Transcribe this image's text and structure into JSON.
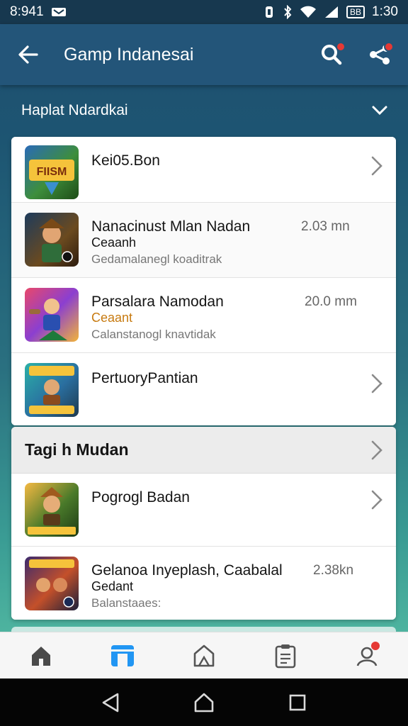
{
  "status_bar": {
    "time_left": "8:941",
    "time_right": "1:30",
    "battery_label": "BB"
  },
  "app_bar": {
    "title": "Gamp Indanesai"
  },
  "section": {
    "title": "Haplat Ndardkai"
  },
  "list1": [
    {
      "title": "Kei05.Bon",
      "subtitle": "",
      "meta": "",
      "size": "",
      "icon": "game-thumbnail-icon"
    },
    {
      "title": "Nanacinust Mlan Nadan",
      "subtitle": "Ceaanh",
      "meta": "Gedamalanegl koaditrak",
      "size": "2.03 mn",
      "icon": "game-thumbnail-icon"
    },
    {
      "title": "Parsalara Namodan",
      "subtitle": "Ceaant",
      "meta": "Calanstanogl knavtidak",
      "size": "20.0 mm",
      "icon": "game-thumbnail-icon"
    },
    {
      "title": "PertuoryPantian",
      "subtitle": "",
      "meta": "",
      "size": "",
      "icon": "game-thumbnail-icon"
    }
  ],
  "group2": {
    "title": "Tagi h Mudan"
  },
  "list2": [
    {
      "title": "Pogrogl Badan",
      "subtitle": "",
      "meta": "",
      "size": "",
      "icon": "game-thumbnail-icon"
    },
    {
      "title": "Gelanoa Inyeplash, Caabalal",
      "subtitle": "Gedant",
      "meta": "Balanstaaes:",
      "size": "2.38kn",
      "icon": "game-thumbnail-icon"
    }
  ],
  "colors": {
    "app_bar": "#235579",
    "accent": "#2196f3",
    "badge": "#e53935",
    "orange_text": "#c77a10"
  }
}
